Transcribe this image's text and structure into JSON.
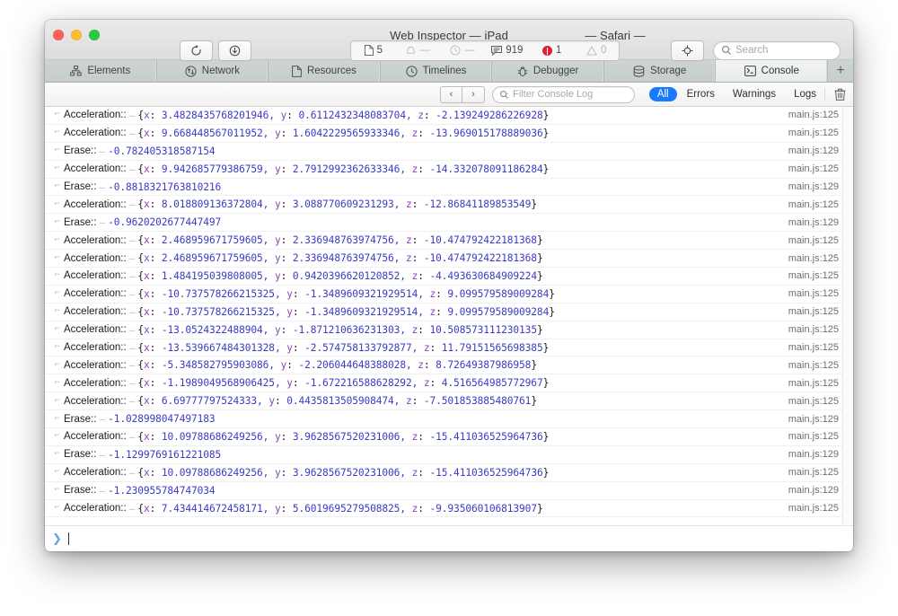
{
  "window": {
    "title": "Web Inspector — iPad",
    "title_secondary": "— Safari —",
    "traffic_lights": [
      "close-button",
      "minimize-button",
      "zoom-button"
    ]
  },
  "toolbar": {
    "reload_icon": "reload-icon",
    "download_icon": "download-icon",
    "inspect_icon": "inspect-node-icon",
    "search": {
      "placeholder": "Search",
      "value": "",
      "icon": "search-icon"
    },
    "dashboard": {
      "resources": {
        "icon": "document-icon",
        "value": "5"
      },
      "alerts": {
        "icon": "bell-icon",
        "value": "—"
      },
      "time": {
        "icon": "clock-icon",
        "value": "—"
      },
      "logs": {
        "icon": "console-message-icon",
        "value": "919"
      },
      "errors": {
        "icon": "error-badge-icon",
        "value": "1"
      },
      "warnings": {
        "icon": "warning-triangle-icon",
        "value": "0"
      }
    }
  },
  "tabs": [
    {
      "label": "Elements",
      "icon": "elements-icon",
      "active": false
    },
    {
      "label": "Network",
      "icon": "network-icon",
      "active": false
    },
    {
      "label": "Resources",
      "icon": "resources-icon",
      "active": false
    },
    {
      "label": "Timelines",
      "icon": "timelines-icon",
      "active": false
    },
    {
      "label": "Debugger",
      "icon": "debugger-icon",
      "active": false
    },
    {
      "label": "Storage",
      "icon": "storage-icon",
      "active": false
    },
    {
      "label": "Console",
      "icon": "console-icon",
      "active": true
    }
  ],
  "tab_add_label": "+",
  "console_toolbar": {
    "prev_label": "‹",
    "next_label": "›",
    "filter": {
      "placeholder": "Filter Console Log",
      "value": "",
      "icon": "search-icon"
    },
    "scopes": [
      {
        "label": "All",
        "active": true
      },
      {
        "label": "Errors",
        "active": false
      },
      {
        "label": "Warnings",
        "active": false
      },
      {
        "label": "Logs",
        "active": false
      }
    ],
    "clear_icon": "trash-icon"
  },
  "log": {
    "row_icon": "log-entry-icon",
    "accent_color": "#3b3bc4",
    "key_color": "#8a46b5",
    "rows": [
      {
        "label": "Acceleration::",
        "value": "{x: 3.4828435768201946, y: 0.6112432348083704, z: -2.139249286226928}",
        "source": "main.js:125"
      },
      {
        "label": "Acceleration::",
        "value": "{x: 9.668448567011952, y: 1.6042229565933346, z: -13.969015178889036}",
        "source": "main.js:125"
      },
      {
        "label": "Erase::",
        "value": "-0.782405318587154",
        "source": "main.js:129"
      },
      {
        "label": "Acceleration::",
        "value": "{x: 9.942685779386759, y: 2.7912992362633346, z: -14.332078091186284}",
        "source": "main.js:125"
      },
      {
        "label": "Erase::",
        "value": "-0.8818321763810216",
        "source": "main.js:129"
      },
      {
        "label": "Acceleration::",
        "value": "{x: 8.018809136372804, y: 3.088770609231293, z: -12.86841189853549}",
        "source": "main.js:125"
      },
      {
        "label": "Erase::",
        "value": "-0.9620202677447497",
        "source": "main.js:129"
      },
      {
        "label": "Acceleration::",
        "value": "{x: 2.468959671759605, y: 2.336948763974756, z: -10.474792422181368}",
        "source": "main.js:125"
      },
      {
        "label": "Acceleration::",
        "value": "{x: 2.468959671759605, y: 2.336948763974756, z: -10.474792422181368}",
        "source": "main.js:125"
      },
      {
        "label": "Acceleration::",
        "value": "{x: 1.484195039808005, y: 0.9420396620120852, z: -4.493630684909224}",
        "source": "main.js:125"
      },
      {
        "label": "Acceleration::",
        "value": "{x: -10.737578266215325, y: -1.3489609321929514, z: 9.099579589009284}",
        "source": "main.js:125"
      },
      {
        "label": "Acceleration::",
        "value": "{x: -10.737578266215325, y: -1.3489609321929514, z: 9.099579589009284}",
        "source": "main.js:125"
      },
      {
        "label": "Acceleration::",
        "value": "{x: -13.0524322488904, y: -1.871210636231303, z: 10.508573111230135}",
        "source": "main.js:125"
      },
      {
        "label": "Acceleration::",
        "value": "{x: -13.539667484301328, y: -2.574758133792877, z: 11.79151565698385}",
        "source": "main.js:125"
      },
      {
        "label": "Acceleration::",
        "value": "{x: -5.348582795903086, y: -2.206044648388028, z: 8.72649387986958}",
        "source": "main.js:125"
      },
      {
        "label": "Acceleration::",
        "value": "{x: -1.1989049568906425, y: -1.672216588628292, z: 4.516564985772967}",
        "source": "main.js:125"
      },
      {
        "label": "Acceleration::",
        "value": "{x: 6.69777797524333, y: 0.4435813505908474, z: -7.501853885480761}",
        "source": "main.js:125"
      },
      {
        "label": "Erase::",
        "value": "-1.028998047497183",
        "source": "main.js:129"
      },
      {
        "label": "Acceleration::",
        "value": "{x: 10.09788686249256, y: 3.9628567520231006, z: -15.411036525964736}",
        "source": "main.js:125"
      },
      {
        "label": "Erase::",
        "value": "-1.1299769161221085",
        "source": "main.js:129"
      },
      {
        "label": "Acceleration::",
        "value": "{x: 10.09788686249256, y: 3.9628567520231006, z: -15.411036525964736}",
        "source": "main.js:125"
      },
      {
        "label": "Erase::",
        "value": "-1.230955784747034",
        "source": "main.js:129"
      },
      {
        "label": "Acceleration::",
        "value": "{x: 7.434414672458171, y: 5.6019695279508825, z: -9.935060106813907}",
        "source": "main.js:125"
      }
    ]
  },
  "prompt": {
    "chevron": "❯",
    "value": ""
  }
}
